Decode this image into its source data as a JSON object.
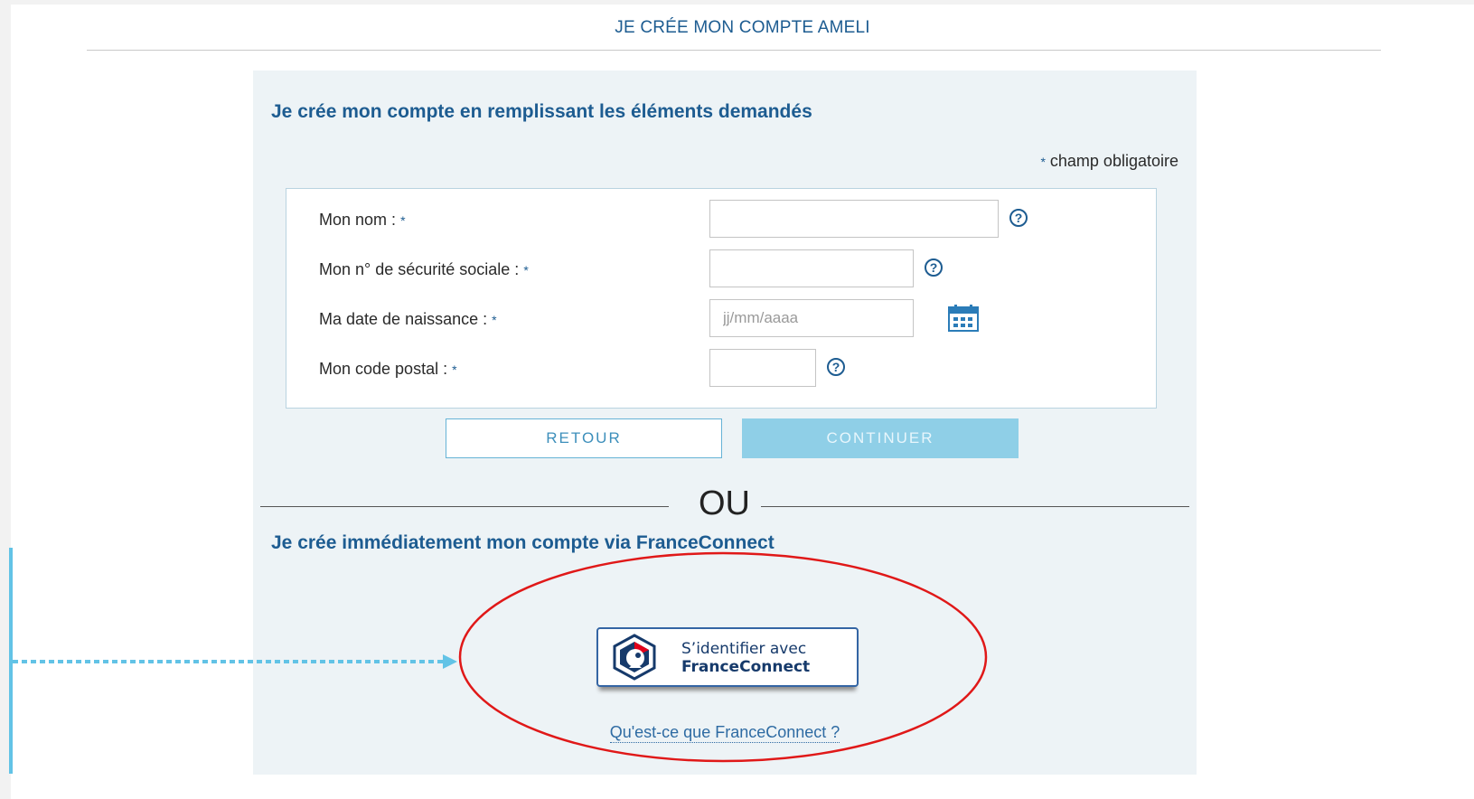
{
  "header": {
    "title": "JE CRÉE MON COMPTE AMELI"
  },
  "form_section": {
    "title": "Je crée mon compte en remplissant les éléments demandés",
    "required_star": "*",
    "required_note": "champ obligatoire",
    "fields": [
      {
        "label": "Mon nom :",
        "star": "*",
        "value": "",
        "placeholder": ""
      },
      {
        "label": "Mon n° de sécurité sociale :",
        "star": "*",
        "value": "",
        "placeholder": ""
      },
      {
        "label": "Ma date de naissance :",
        "star": "*",
        "value": "",
        "placeholder": "jj/mm/aaaa"
      },
      {
        "label": "Mon code postal :",
        "star": "*",
        "value": "",
        "placeholder": ""
      }
    ],
    "help_glyph": "?"
  },
  "buttons": {
    "back": "RETOUR",
    "continue": "CONTINUER"
  },
  "separator": {
    "text": "OU"
  },
  "franceconnect": {
    "title": "Je crée immédiatement mon compte via FranceConnect",
    "button_line1": "S’identifier avec",
    "button_line2": "FranceConnect",
    "link": "Qu'est-ce que FranceConnect ?"
  },
  "colors": {
    "brand_blue": "#1d5c91",
    "panel_bg": "#edf3f6",
    "continue_bg": "#8fcfe7",
    "highlight_ellipse": "#e01818",
    "pointer_arrow": "#62c3e6"
  }
}
